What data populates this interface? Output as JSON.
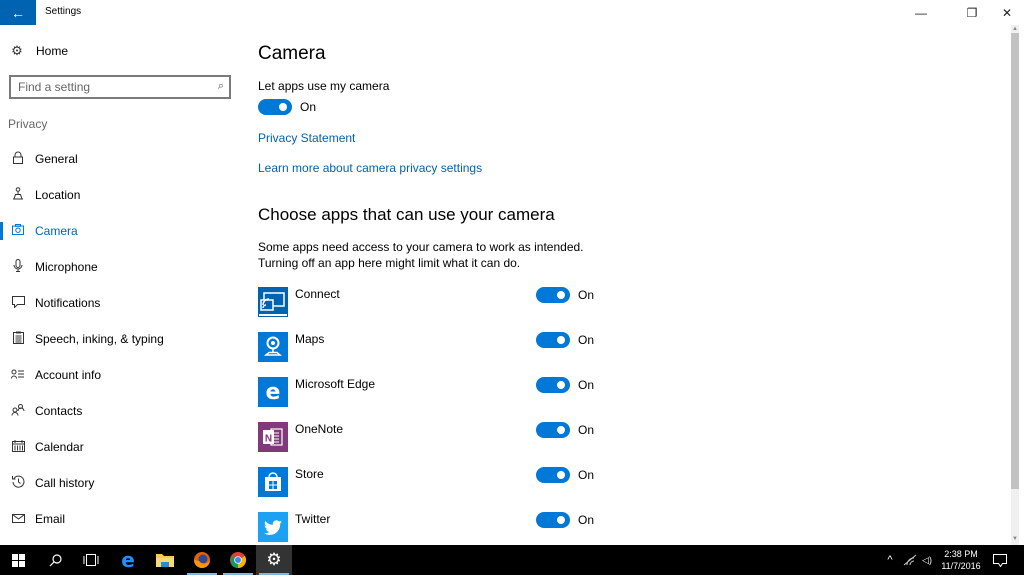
{
  "window": {
    "title": "Settings",
    "back_icon": "←",
    "minimize_icon": "—",
    "restore_icon": "❐",
    "close_icon": "✕"
  },
  "sidebar": {
    "home": {
      "label": "Home",
      "icon": "⚙"
    },
    "search": {
      "placeholder": "Find a setting",
      "icon": "⌕"
    },
    "section": "Privacy",
    "items": [
      {
        "label": "General",
        "icon": "🔒︎",
        "glyph": "⌂",
        "active": false
      },
      {
        "label": "Location",
        "icon": "location-icon",
        "glyph": "⚲",
        "active": false
      },
      {
        "label": "Camera",
        "icon": "camera-icon",
        "glyph": "◙",
        "active": true
      },
      {
        "label": "Microphone",
        "icon": "microphone-icon",
        "glyph": "🎙︎",
        "active": false
      },
      {
        "label": "Notifications",
        "icon": "notifications-icon",
        "glyph": "▭",
        "active": false
      },
      {
        "label": "Speech, inking, & typing",
        "icon": "clipboard-icon",
        "glyph": "▤",
        "active": false
      },
      {
        "label": "Account info",
        "icon": "account-info-icon",
        "glyph": "≡",
        "active": false
      },
      {
        "label": "Contacts",
        "icon": "contacts-icon",
        "glyph": "⚇",
        "active": false
      },
      {
        "label": "Calendar",
        "icon": "calendar-icon",
        "glyph": "▦",
        "active": false
      },
      {
        "label": "Call history",
        "icon": "call-history-icon",
        "glyph": "↺",
        "active": false
      },
      {
        "label": "Email",
        "icon": "email-icon",
        "glyph": "✉",
        "active": false
      }
    ]
  },
  "main": {
    "title": "Camera",
    "master_toggle": {
      "label": "Let apps use my camera",
      "state": "On",
      "on": true
    },
    "links": [
      "Privacy Statement",
      "Learn more about camera privacy settings"
    ],
    "apps_heading": "Choose apps that can use your camera",
    "apps_description": [
      "Some apps need access to your camera to work as intended.",
      "Turning off an app here might limit what it can do."
    ],
    "apps": [
      {
        "name": "Connect",
        "state": "On",
        "on": true,
        "color": "#0063b1",
        "glyph": "⌁"
      },
      {
        "name": "Maps",
        "state": "On",
        "on": true,
        "color": "#0078d7",
        "glyph": "⚲"
      },
      {
        "name": "Microsoft Edge",
        "state": "On",
        "on": true,
        "color": "#0078d7",
        "glyph": "e"
      },
      {
        "name": "OneNote",
        "state": "On",
        "on": true,
        "color": "#80397b",
        "glyph": "N"
      },
      {
        "name": "Store",
        "state": "On",
        "on": true,
        "color": "#0078d7",
        "glyph": "⊞"
      },
      {
        "name": "Twitter",
        "state": "On",
        "on": true,
        "color": "#1da1f2",
        "glyph": "🐦︎"
      }
    ]
  },
  "taskbar": {
    "items": [
      {
        "name": "start",
        "glyph": "⊞"
      },
      {
        "name": "search",
        "glyph": "⚲"
      },
      {
        "name": "task-view",
        "glyph": "▯"
      },
      {
        "name": "edge",
        "glyph": "e"
      },
      {
        "name": "file-explorer",
        "glyph": "▬"
      },
      {
        "name": "firefox",
        "glyph": "●"
      },
      {
        "name": "chrome",
        "glyph": "◉"
      },
      {
        "name": "settings",
        "glyph": "⚙"
      }
    ],
    "tray": {
      "chevron": "^",
      "wifi": "◠",
      "volume": "◁)"
    },
    "time": "2:38 PM",
    "date": "11/7/2016",
    "action_center": "▭"
  }
}
